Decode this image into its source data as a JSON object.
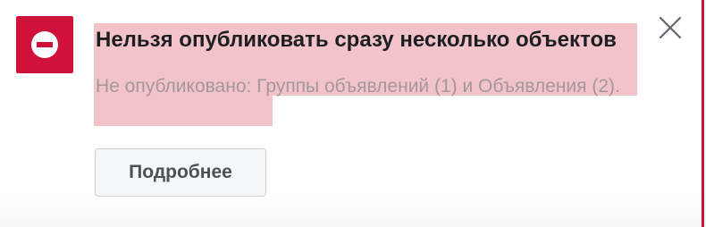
{
  "notice": {
    "title": "Нельзя опубликовать сразу несколько объектов",
    "message": "Не опубликовано: Группы объявлений (1) и Объявления (2).",
    "details_button_label": "Подробнее",
    "status_icon": "stop-icon",
    "close_icon": "close-icon",
    "accent_color": "#d0123a",
    "highlight_color": "#f2c4c9"
  }
}
